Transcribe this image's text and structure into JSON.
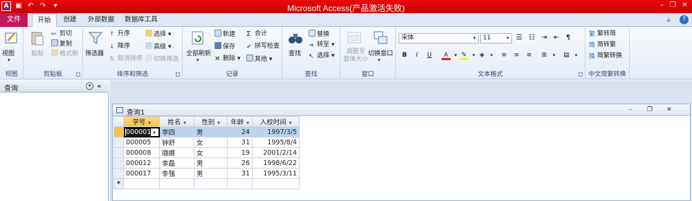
{
  "window": {
    "app_icon_letter": "A",
    "title": "Microsoft Access(产品激活失败)"
  },
  "tabs": {
    "file": "文件",
    "items": [
      "开始",
      "创建",
      "外部数据",
      "数据库工具"
    ],
    "active": "开始"
  },
  "ribbon": {
    "view": {
      "label": "视图",
      "group": "视图"
    },
    "clipboard": {
      "paste": "粘贴",
      "cut": "剪切",
      "copy": "复制",
      "format_painter": "格式刷",
      "group": "剪贴板"
    },
    "sort_filter": {
      "filter": "筛选器",
      "ascending": "升序",
      "descending": "降序",
      "remove_sort": "取消排序",
      "selection": "选择 ▾",
      "advanced": "高级 ▾",
      "toggle_filter": "切换筛选",
      "group": "排序和筛选"
    },
    "records": {
      "refresh_all": "全部刷新",
      "new": "新建",
      "save": "保存",
      "delete": "删除 ▾",
      "totals": "合计",
      "spelling": "拼写检查",
      "more": "其他 ▾",
      "group": "记录"
    },
    "find": {
      "find": "查找",
      "replace": "替换",
      "goto": "转至 ▾",
      "select": "选择 ▾",
      "group": "查找"
    },
    "window": {
      "size_to_fit": "调整至\n窗体大小",
      "switch_windows": "切换窗口",
      "group": "窗口"
    },
    "text_format": {
      "font": "宋体",
      "size": "11",
      "bold": "B",
      "italic": "I",
      "underline": "U",
      "group": "文本格式"
    },
    "chinese_conv": {
      "trad_to_simp": "繁转简",
      "simp_to_trad": "简转繁",
      "conv": "简繁转换",
      "group": "中文简繁转换"
    }
  },
  "nav_pane": {
    "title": "查询"
  },
  "query_window": {
    "title": "查询1",
    "columns": [
      "学号",
      "姓名",
      "性别",
      "年龄",
      "入校时间"
    ],
    "rows": [
      [
        "000001",
        "李四",
        "男",
        "24",
        "1997/3/5"
      ],
      [
        "000005",
        "钟舒",
        "女",
        "31",
        "1995/8/4"
      ],
      [
        "000008",
        "璐娜",
        "女",
        "19",
        "2001/2/14"
      ],
      [
        "000012",
        "李磊",
        "男",
        "26",
        "1998/6/22"
      ],
      [
        "000017",
        "李强",
        "男",
        "31",
        "1995/3/11"
      ]
    ],
    "new_row_marker": "*"
  },
  "colors": {
    "title_bar": "#e80a0a",
    "file_tab": "#c2175b",
    "selected_header": "#f7c24a",
    "current_row": "#bcd3ee"
  }
}
